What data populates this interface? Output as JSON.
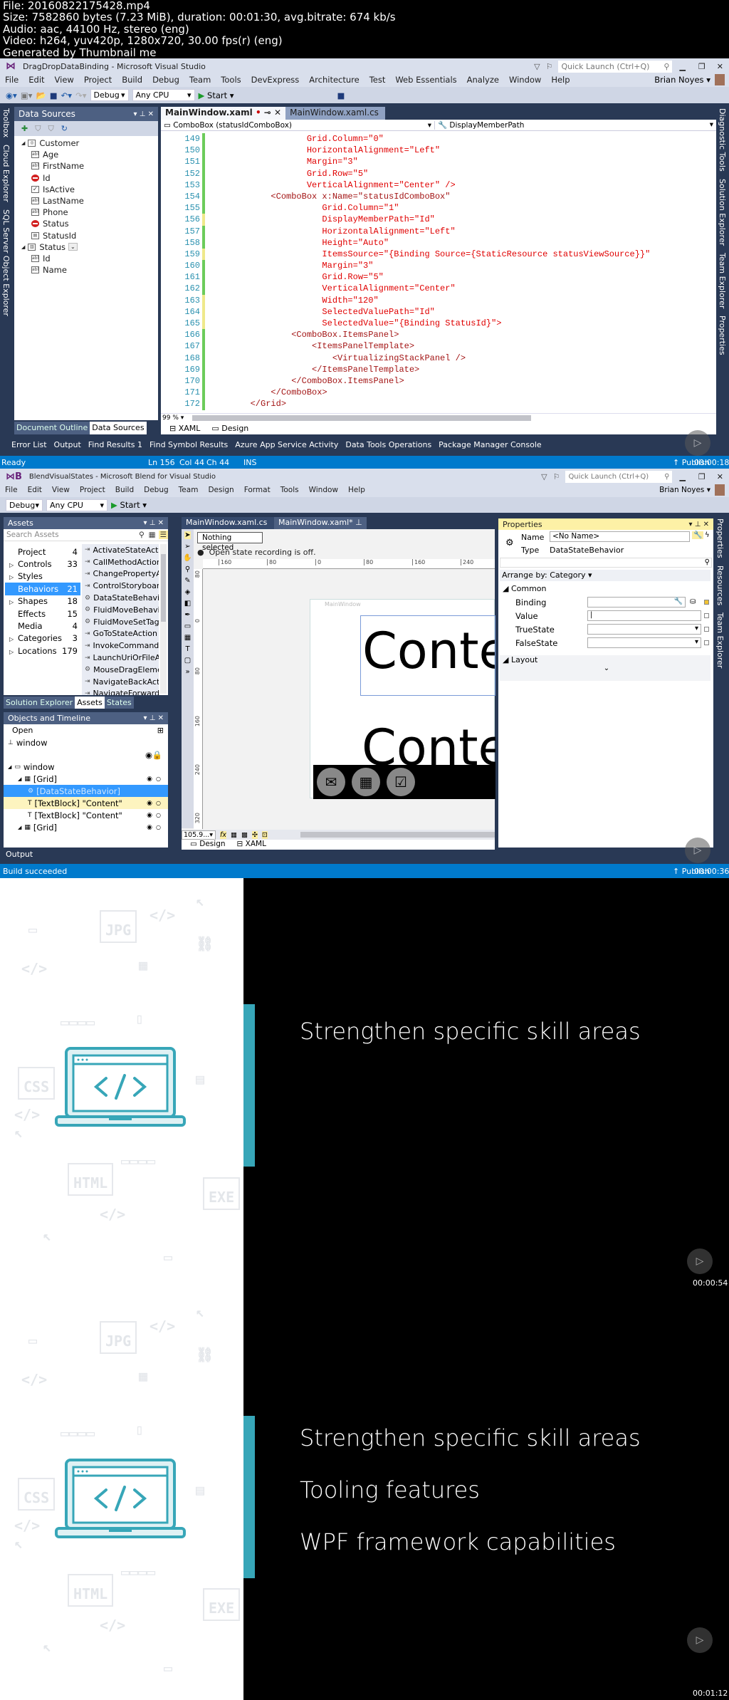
{
  "header_info": [
    "File: 20160822175428.mp4",
    "Size: 7582860 bytes (7.23 MiB), duration: 00:01:30, avg.bitrate: 674 kb/s",
    "Audio: aac, 44100 Hz, stereo (eng)",
    "Video: h264, yuv420p, 1280x720, 30.00 fps(r) (eng)",
    "Generated by Thumbnail me"
  ],
  "vs": {
    "title": "DragDropDataBinding - Microsoft Visual Studio",
    "quick_launch": "Quick Launch (Ctrl+Q)",
    "user": "Brian Noyes",
    "menu": [
      "File",
      "Edit",
      "View",
      "Project",
      "Build",
      "Debug",
      "Team",
      "Tools",
      "DevExpress",
      "Architecture",
      "Test",
      "Web Essentials",
      "Analyze",
      "Window",
      "Help"
    ],
    "toolbar": {
      "config": "Debug",
      "platform": "Any CPU",
      "start": "Start"
    },
    "left_strip": [
      "Toolbox",
      "Cloud Explorer",
      "SQL Server Object Explorer"
    ],
    "right_strip": [
      "Diagnostic Tools",
      "Solution Explorer",
      "Team Explorer",
      "Properties"
    ],
    "data_sources": {
      "title": "Data Sources",
      "tree": [
        {
          "label": "Customer",
          "icon": "object",
          "level": 0,
          "expanded": true
        },
        {
          "label": "Age",
          "icon": "textbox",
          "level": 1
        },
        {
          "label": "FirstName",
          "icon": "textbox",
          "level": 1
        },
        {
          "label": "Id",
          "icon": "none",
          "level": 1
        },
        {
          "label": "IsActive",
          "icon": "checkbox",
          "level": 1
        },
        {
          "label": "LastName",
          "icon": "textbox",
          "level": 1
        },
        {
          "label": "Phone",
          "icon": "textbox",
          "level": 1
        },
        {
          "label": "Status",
          "icon": "none",
          "level": 1
        },
        {
          "label": "StatusId",
          "icon": "combobox",
          "level": 1
        },
        {
          "label": "Status",
          "icon": "table",
          "level": 0,
          "expanded": true,
          "dropdown": true
        },
        {
          "label": "Id",
          "icon": "textbox",
          "level": 1
        },
        {
          "label": "Name",
          "icon": "textbox",
          "level": 1
        }
      ]
    },
    "tabs": [
      {
        "label": "MainWindow.xaml",
        "active": true,
        "modified": true
      },
      {
        "label": "MainWindow.xaml.cs",
        "active": false,
        "modified": true
      }
    ],
    "nav": {
      "left": "ComboBox (statusIdComboBox)",
      "right": "DisplayMemberPath"
    },
    "code": [
      {
        "num": "149",
        "text": "                   Grid.Column=\"0\"",
        "change": "green"
      },
      {
        "num": "150",
        "text": "                   HorizontalAlignment=\"Left\"",
        "change": "green"
      },
      {
        "num": "151",
        "text": "                   Margin=\"3\"",
        "change": "green"
      },
      {
        "num": "152",
        "text": "                   Grid.Row=\"5\"",
        "change": "green"
      },
      {
        "num": "153",
        "text": "                   VerticalAlignment=\"Center\" />",
        "change": "green"
      },
      {
        "num": "154",
        "text": "            <ComboBox x:Name=\"statusIdComboBox\"",
        "change": "green"
      },
      {
        "num": "155",
        "text": "                      Grid.Column=\"1\"",
        "change": "green"
      },
      {
        "num": "156",
        "text": "                      DisplayMemberPath=\"Id\"",
        "change": "yellow"
      },
      {
        "num": "157",
        "text": "                      HorizontalAlignment=\"Left\"",
        "change": "green"
      },
      {
        "num": "158",
        "text": "                      Height=\"Auto\"",
        "change": "green"
      },
      {
        "num": "159",
        "text": "                      ItemsSource=\"{Binding Source={StaticResource statusViewSource}}\"",
        "change": "yellow"
      },
      {
        "num": "160",
        "text": "                      Margin=\"3\"",
        "change": "green"
      },
      {
        "num": "161",
        "text": "                      Grid.Row=\"5\"",
        "change": "green"
      },
      {
        "num": "162",
        "text": "                      VerticalAlignment=\"Center\"",
        "change": "green"
      },
      {
        "num": "163",
        "text": "                      Width=\"120\"",
        "change": "yellow"
      },
      {
        "num": "164",
        "text": "                      SelectedValuePath=\"Id\"",
        "change": "yellow"
      },
      {
        "num": "165",
        "text": "                      SelectedValue=\"{Binding StatusId}\">",
        "change": "yellow"
      },
      {
        "num": "166",
        "text": "                <ComboBox.ItemsPanel>",
        "change": "green"
      },
      {
        "num": "167",
        "text": "                    <ItemsPanelTemplate>",
        "change": "green"
      },
      {
        "num": "168",
        "text": "                        <VirtualizingStackPanel />",
        "change": "green"
      },
      {
        "num": "169",
        "text": "                    </ItemsPanelTemplate>",
        "change": "green"
      },
      {
        "num": "170",
        "text": "                </ComboBox.ItemsPanel>",
        "change": "green"
      },
      {
        "num": "171",
        "text": "            </ComboBox>",
        "change": "green"
      },
      {
        "num": "172",
        "text": "        </Grid>",
        "change": "green"
      }
    ],
    "zoom": "99 %",
    "view_tabs": [
      "XAML",
      "Design"
    ],
    "panel_tabs": [
      "Document Outline",
      "Data Sources"
    ],
    "bottom_tabs": [
      "Error List",
      "Output",
      "Find Results 1",
      "Find Symbol Results",
      "Azure App Service Activity",
      "Data Tools Operations",
      "Package Manager Console"
    ],
    "status": {
      "ready": "Ready",
      "ln": "Ln 156",
      "col": "Col 44",
      "ch": "Ch 44",
      "ins": "INS",
      "publish": "Publish"
    },
    "timestamp": "00:00:18"
  },
  "blend": {
    "title": "BlendVisualStates - Microsoft Blend for Visual Studio",
    "quick_launch": "Quick Launch (Ctrl+Q)",
    "user": "Brian Noyes",
    "menu": [
      "File",
      "Edit",
      "View",
      "Project",
      "Build",
      "Debug",
      "Team",
      "Design",
      "Format",
      "Tools",
      "Window",
      "Help"
    ],
    "toolbar": {
      "config": "Debug",
      "platform": "Any CPU",
      "start": "Start"
    },
    "assets": {
      "title": "Assets",
      "search_placeholder": "Search Assets",
      "categories": [
        {
          "label": "Project",
          "count": "4"
        },
        {
          "label": "Controls",
          "count": "33",
          "expandable": true
        },
        {
          "label": "Styles",
          "count": "",
          "expandable": true
        },
        {
          "label": "Behaviors",
          "count": "21",
          "selected": true
        },
        {
          "label": "Shapes",
          "count": "18",
          "expandable": true
        },
        {
          "label": "Effects",
          "count": "15"
        },
        {
          "label": "Media",
          "count": "4"
        },
        {
          "label": "Categories",
          "count": "3",
          "expandable": true
        },
        {
          "label": "Locations",
          "count": "179",
          "expandable": true
        }
      ],
      "items": [
        {
          "label": "ActivateStateAction",
          "icon": "action"
        },
        {
          "label": "CallMethodAction",
          "icon": "action"
        },
        {
          "label": "ChangePropertyActi...",
          "icon": "action"
        },
        {
          "label": "ControlStoryboardA...",
          "icon": "action"
        },
        {
          "label": "DataStateBehavior",
          "icon": "behavior"
        },
        {
          "label": "FluidMoveBehavior",
          "icon": "behavior"
        },
        {
          "label": "FluidMoveSetTagBe...",
          "icon": "behavior"
        },
        {
          "label": "GoToStateAction",
          "icon": "action"
        },
        {
          "label": "InvokeCommandActi...",
          "icon": "action"
        },
        {
          "label": "LaunchUriOrFileAction",
          "icon": "action"
        },
        {
          "label": "MouseDragElement...",
          "icon": "behavior"
        },
        {
          "label": "NavigateBackAction",
          "icon": "action"
        },
        {
          "label": "NavigateForwardAct...",
          "icon": "action"
        }
      ]
    },
    "panel_tabs": [
      "Solution Explorer",
      "Assets",
      "States"
    ],
    "objects": {
      "title": "Objects and Timeline",
      "open": "Open",
      "rows": [
        {
          "label": "window",
          "level": 0,
          "icon": "up"
        },
        {
          "label": "",
          "level": 0,
          "icon": "eye-lock"
        },
        {
          "label": "window",
          "level": 0,
          "icon": "window",
          "expanded": true
        },
        {
          "label": "[Grid]",
          "level": 1,
          "icon": "grid",
          "expanded": true,
          "eye": true
        },
        {
          "label": "[DataStateBehavior]",
          "level": 2,
          "icon": "behavior",
          "selected": true
        },
        {
          "label": "[TextBlock] \"Content\"",
          "level": 2,
          "icon": "text",
          "hover": true,
          "eye": true
        },
        {
          "label": "[TextBlock] \"Content\"",
          "level": 2,
          "icon": "text",
          "eye": true
        },
        {
          "label": "[Grid]",
          "level": 1,
          "icon": "grid",
          "expanded": true,
          "eye": true
        }
      ]
    },
    "output": "Output",
    "doc_tabs": [
      {
        "label": "MainWindow.xaml.cs",
        "active": false
      },
      {
        "label": "MainWindow.xaml*",
        "active": true
      }
    ],
    "selection": "Nothing selected",
    "recording": "Open state recording is off.",
    "ruler_h": [
      "160",
      "80",
      "0",
      "80",
      "160",
      "240"
    ],
    "ruler_v": [
      "80",
      "0",
      "80",
      "160",
      "240",
      "320"
    ],
    "artboard_title": "MainWindow",
    "content_text": "Content",
    "zoom": "105.9...",
    "view_tabs": [
      "Design",
      "XAML"
    ],
    "properties": {
      "title": "Properties",
      "name_label": "Name",
      "name_value": "<No Name>",
      "type_label": "Type",
      "type_value": "DataStateBehavior",
      "arrange": "Arrange by: Category",
      "common": "Common",
      "fields": [
        {
          "label": "Binding",
          "kind": "binding"
        },
        {
          "label": "Value",
          "kind": "text"
        },
        {
          "label": "TrueState",
          "kind": "dropdown"
        },
        {
          "label": "FalseState",
          "kind": "dropdown"
        }
      ],
      "layout": "Layout"
    },
    "right_strip": [
      "Properties",
      "Resources",
      "Team Explorer"
    ],
    "status": "Build succeeded",
    "publish": "Publish",
    "timestamp": "00:00:36"
  },
  "slides": [
    {
      "lines": [
        "Strengthen specific skill areas"
      ],
      "timestamp": "00:00:54"
    },
    {
      "lines": [
        "Strengthen specific skill areas",
        "Tooling features",
        "WPF framework capabilities"
      ],
      "timestamp": "00:01:12"
    }
  ],
  "pattern_labels": [
    "JPG",
    "CSS",
    "HTML",
    "EXE"
  ],
  "colors": {
    "accent": "#37a6b8",
    "vs_frame": "#293955",
    "status_bar": "#007acc",
    "selection": "#3399ff"
  }
}
